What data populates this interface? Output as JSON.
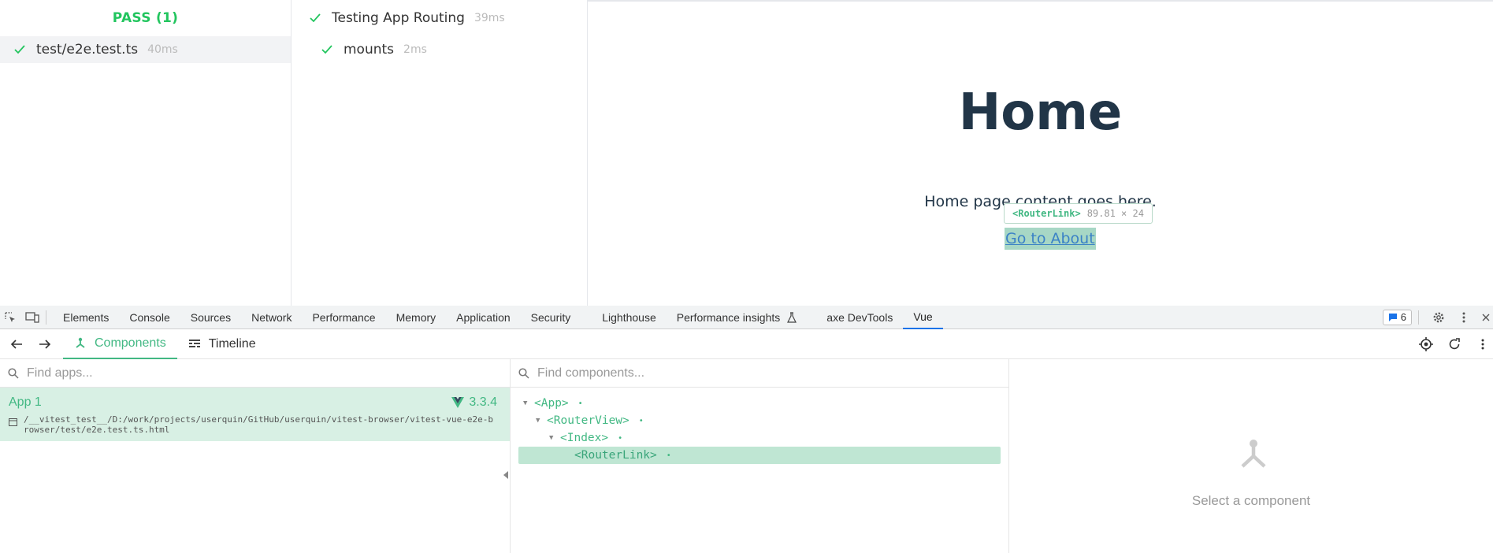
{
  "runner": {
    "pass_header": "PASS (1)",
    "files": [
      {
        "name": "test/e2e.test.ts",
        "duration": "40ms"
      }
    ],
    "tests": [
      {
        "name": "Testing App Routing",
        "duration": "39ms"
      },
      {
        "name": "mounts",
        "duration": "2ms"
      }
    ]
  },
  "preview": {
    "title": "Home",
    "text": "Home page content goes here.",
    "tooltip_component": "<RouterLink>",
    "tooltip_size": "89.81 × 24",
    "link_text": "Go to About"
  },
  "devtools": {
    "tabs": [
      "Elements",
      "Console",
      "Sources",
      "Network",
      "Performance",
      "Memory",
      "Application",
      "Security",
      "Lighthouse",
      "Performance insights",
      "axe DevTools",
      "Vue"
    ],
    "active_tab": "Vue",
    "issues_count": "6"
  },
  "vue": {
    "tabs": {
      "components": "Components",
      "timeline": "Timeline"
    },
    "apps_search_placeholder": "Find apps...",
    "components_search_placeholder": "Find components...",
    "app": {
      "name": "App 1",
      "version": "3.3.4",
      "path": "/__vitest_test__/D:/work/projects/userquin/GitHub/userquin/vitest-browser/vitest-vue-e2e-browser/test/e2e.test.ts.html"
    },
    "tree": [
      "<App>",
      "<RouterView>",
      "<Index>",
      "<RouterLink>"
    ],
    "detail_empty": "Select a component"
  },
  "colors": {
    "vue_green": "#42b883",
    "pass_green": "#22c55e",
    "selected_bg": "#bfe6d3",
    "devtools_active": "#1a73e8"
  }
}
